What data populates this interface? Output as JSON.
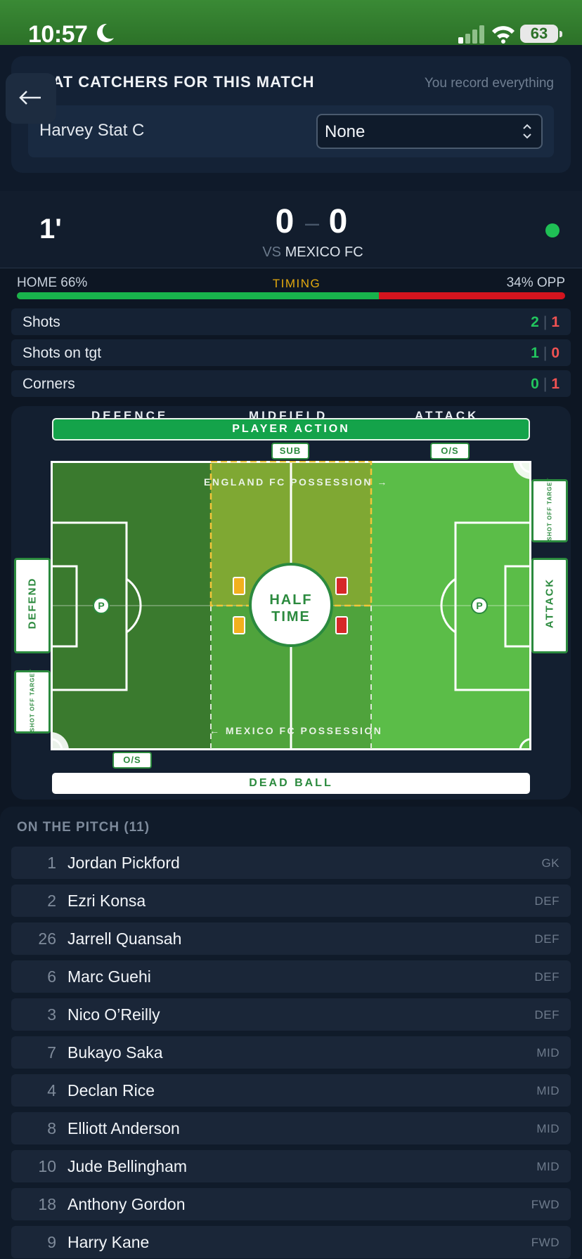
{
  "status_bar": {
    "time": "10:57",
    "battery": "63"
  },
  "stat_catchers": {
    "title": "STAT CATCHERS FOR THIS MATCH",
    "note": "You record everything",
    "catcher_name": "Harvey Stat C",
    "selected": "None"
  },
  "match": {
    "minute": "1'",
    "home_score": "0",
    "separator": "–",
    "away_score": "0",
    "vs_prefix": "VS",
    "opponent": "MEXICO FC"
  },
  "possession": {
    "home_label": "HOME 66%",
    "center_label": "TIMING",
    "opp_label": "34% OPP",
    "home_pct": 66,
    "home_color": "#18b34c",
    "opp_color": "#d4141e"
  },
  "stats": [
    {
      "label": "Shots",
      "home": "2",
      "sep": "|",
      "away": "1"
    },
    {
      "label": "Shots on tgt",
      "home": "1",
      "sep": "|",
      "away": "0"
    },
    {
      "label": "Corners",
      "home": "0",
      "sep": "|",
      "away": "1"
    }
  ],
  "pitch": {
    "zones": [
      "DEFENCE",
      "MIDFIELD",
      "ATTACK"
    ],
    "player_action": "PLAYER ACTION",
    "sub": "SUB",
    "offside_top": "O/S",
    "offside_bottom": "O/S",
    "home_possession": "ENGLAND FC POSSESSION →",
    "away_possession": "← MEXICO FC POSSESSION",
    "half_time_1": "HALF",
    "half_time_2": "TIME",
    "penalty_left": "P",
    "penalty_right": "P",
    "defend": "DEFEND",
    "attack": "ATTACK",
    "shot_off_target_right": "SHOT OFF TARGET",
    "shot_off_target_left": "SHOT OFF TARGET",
    "dead_ball": "DEAD BALL",
    "grass_colors": {
      "left": "#3a7a2e",
      "mid": "#4fa33c",
      "right": "#5bbd48",
      "highlight": "#7fa833"
    }
  },
  "roster": {
    "title": "ON THE PITCH (11)",
    "players": [
      {
        "num": "1",
        "name": "Jordan Pickford",
        "pos": "GK"
      },
      {
        "num": "2",
        "name": "Ezri Konsa",
        "pos": "DEF"
      },
      {
        "num": "26",
        "name": "Jarrell Quansah",
        "pos": "DEF"
      },
      {
        "num": "6",
        "name": "Marc Guehi",
        "pos": "DEF"
      },
      {
        "num": "3",
        "name": "Nico O’Reilly",
        "pos": "DEF"
      },
      {
        "num": "7",
        "name": "Bukayo Saka",
        "pos": "MID"
      },
      {
        "num": "4",
        "name": "Declan Rice",
        "pos": "MID"
      },
      {
        "num": "8",
        "name": "Elliott Anderson",
        "pos": "MID"
      },
      {
        "num": "10",
        "name": "Jude Bellingham",
        "pos": "MID"
      },
      {
        "num": "18",
        "name": "Anthony Gordon",
        "pos": "FWD"
      },
      {
        "num": "9",
        "name": "Harry Kane",
        "pos": "FWD"
      }
    ]
  }
}
